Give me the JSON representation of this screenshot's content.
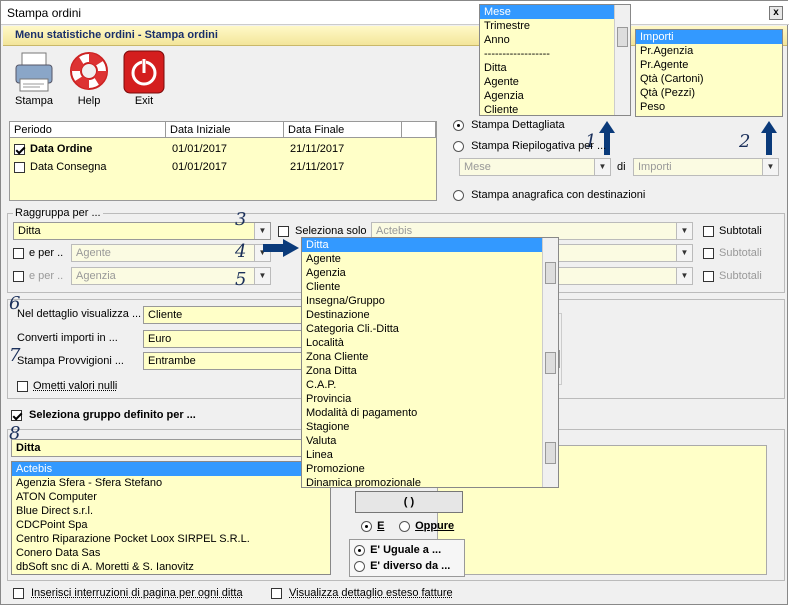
{
  "window": {
    "title": "Stampa ordini",
    "close": "x"
  },
  "band": {
    "title": "Menu statistiche ordini - Stampa ordini"
  },
  "toolbar": [
    {
      "label": "Stampa"
    },
    {
      "label": "Help"
    },
    {
      "label": "Exit"
    }
  ],
  "periods": {
    "headers": [
      "Periodo",
      "Data Iniziale",
      "Data Finale"
    ],
    "rows": [
      {
        "label": "Data Ordine",
        "from": "01/01/2017",
        "to": "21/11/2017"
      },
      {
        "label": "Data Consegna",
        "from": "01/01/2017",
        "to": "21/11/2017"
      }
    ]
  },
  "period_list": [
    "Mese",
    "Trimestre",
    "Anno",
    "------------------",
    "Ditta",
    "Agente",
    "Agenzia",
    "Cliente"
  ],
  "measure_list": [
    "Importi",
    "Pr.Agenzia",
    "Pr.Agente",
    "Qtà (Cartoni)",
    "Qtà (Pezzi)",
    "Peso"
  ],
  "print_opts": {
    "detailed": "Stampa Dettagliata",
    "summary": "Stampa Riepilogativa per ...",
    "mese": "Mese",
    "di": "di",
    "importi": "Importi",
    "anagrafica": "Stampa anagrafica con destinazioni"
  },
  "annotations": {
    "n1": "1",
    "n2": "2",
    "n3": "3",
    "n4": "4",
    "n5": "5",
    "n6": "6",
    "n7": "7",
    "n8": "8"
  },
  "raggruppa": {
    "legend": "Raggruppa per ...",
    "main": "Ditta",
    "e_per": "e per ..",
    "agente": "Agente",
    "agenzia": "Agenzia",
    "seleziona_solo": "Seleziona solo",
    "seleziona_value": "Actebis",
    "subtotali": "Subtotali"
  },
  "dropdown": [
    "Ditta",
    "Agente",
    "Agenzia",
    "Cliente",
    "Insegna/Gruppo",
    "Destinazione",
    "Categoria Cli.-Ditta",
    "Località",
    "Zona Cliente",
    "Zona Ditta",
    "C.A.P.",
    "Provincia",
    "Modalità di pagamento",
    "Stagione",
    "Valuta",
    "Linea",
    "Promozione",
    "Dinamica promozionale"
  ],
  "details": {
    "visualizza_label": "Nel dettaglio visualizza ...",
    "visualizza_value": "Cliente",
    "converti_label": "Converti importi in  ...",
    "converti_value": "Euro",
    "provvigioni_label": "Stampa Provvigioni  ...",
    "provvigioni_value": "Entrambe",
    "ometti": "Ometti valori nulli"
  },
  "gruppo": {
    "check_label": "Seleziona gruppo definito per ...",
    "value": "Ditta",
    "items": [
      "Actebis",
      "Agenzia Sfera - Sfera Stefano",
      "ATON Computer",
      "Blue Direct s.r.l.",
      "CDCPoint Spa",
      "Centro Riparazione Pocket Loox SIRPEL S.R.L.",
      "Conero Data Sas",
      "dbSoft snc di A. Moretti & S. Ianovitz"
    ]
  },
  "logic": {
    "paren": "( )",
    "and": "E",
    "or": "Oppure",
    "eq": "E' Uguale a ...",
    "neq": "E' diverso da ..."
  },
  "footer": {
    "interruzioni": "Inserisci interruzioni di pagina per ogni ditta",
    "esteso": "Visualizza dettaglio esteso fatture"
  }
}
